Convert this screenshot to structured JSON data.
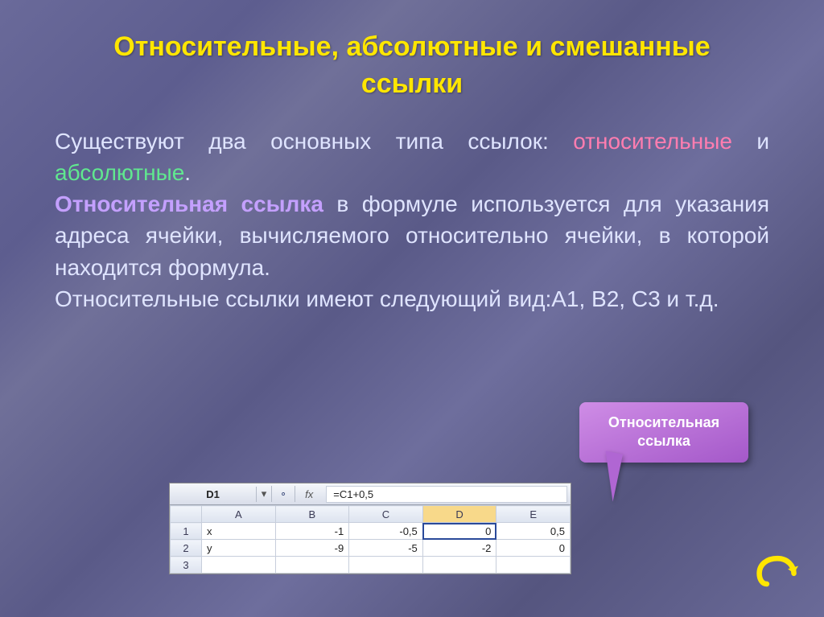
{
  "title_line1": "Относительные, абсолютные и  смешанные",
  "title_line2": "ссылки",
  "para1_a": "Существуют два основных типа ссылок: ",
  "para1_rel": "относительные",
  "para1_mid": " и ",
  "para1_abs": "абсолютные",
  "para1_end": ".",
  "para2_head": "Относительная ссылка",
  "para2_body": " в формуле используется для указания адреса ячейки, вычисляемого относительно ячейки, в которой находится формула.",
  "para3": "Относительные ссылки имеют следующий вид:A1, В2, С3 и т.д.",
  "callout_l1": "Относительная",
  "callout_l2": "ссылка",
  "excel": {
    "name_box": "D1",
    "fx": "fx",
    "formula": "=C1+0,5",
    "cols": [
      "A",
      "B",
      "C",
      "D",
      "E"
    ],
    "rows": [
      {
        "n": "1",
        "cells": [
          "x",
          "-1",
          "-0,5",
          "0",
          "0,5"
        ]
      },
      {
        "n": "2",
        "cells": [
          "y",
          "-9",
          "-5",
          "-2",
          "0"
        ]
      },
      {
        "n": "3",
        "cells": [
          "",
          "",
          "",
          "",
          ""
        ]
      }
    ],
    "selected_col_index": 3
  }
}
